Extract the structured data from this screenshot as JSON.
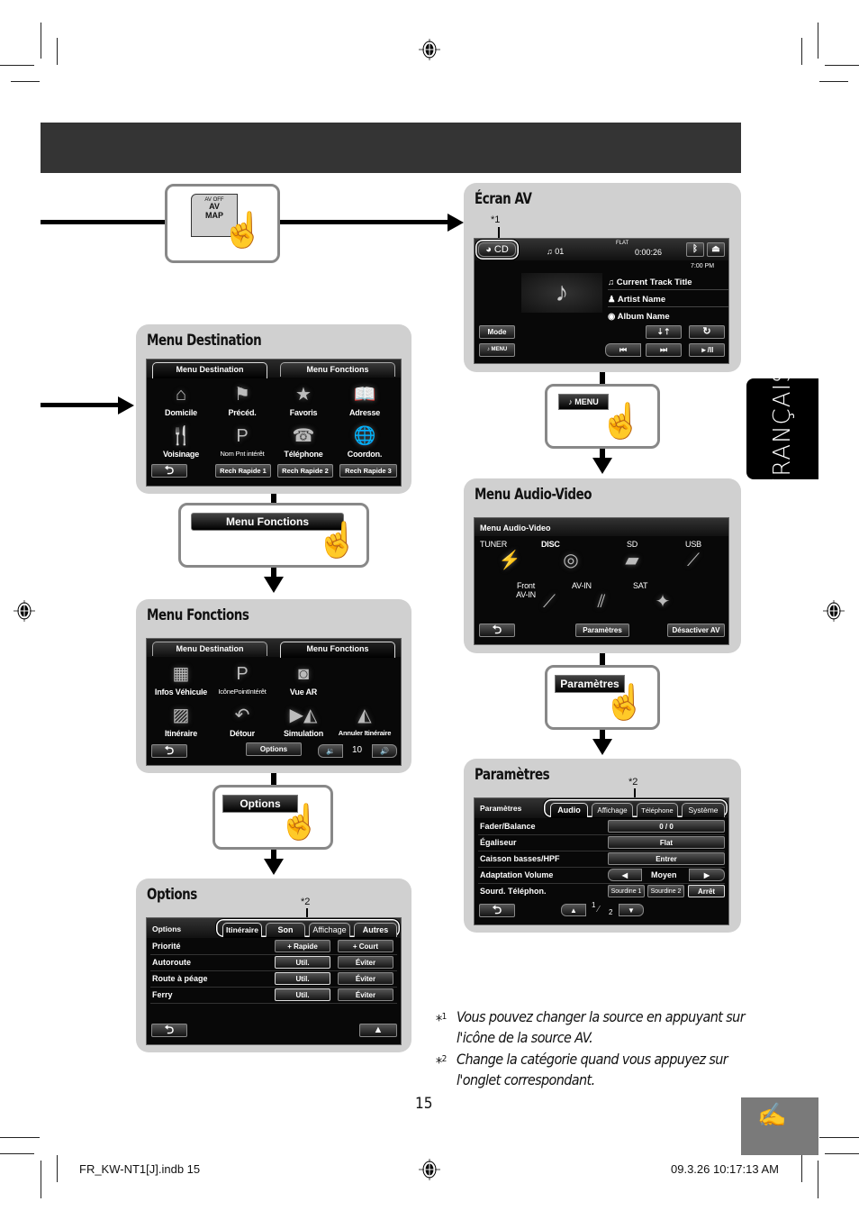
{
  "language_tab": "FRANÇAIS",
  "page_number": "15",
  "footer": {
    "file": "FR_KW-NT1[J].indb   15",
    "timestamp": "09.3.26   10:17:13 AM"
  },
  "colors": {
    "header_band": "#343434",
    "panel_bg": "#d0d0d0",
    "screen_bg": "#080808",
    "thumb_tab": "#7a7a7a"
  },
  "av_map_key": {
    "top_label": "AV OFF",
    "line1": "AV",
    "line2": "MAP"
  },
  "ecran_av": {
    "title": "Écran AV",
    "annotation": "*1",
    "source": "CD",
    "track": "01",
    "eq": "FLAT",
    "elapsed": "0:00:26",
    "clock": "7:00 PM",
    "track_title": "Current Track Title",
    "artist": "Artist Name",
    "album": "Album Name",
    "buttons": {
      "mode": "Mode",
      "menu": "MENU",
      "shuffle": "⇣⇡",
      "repeat": "↻",
      "prev": "⏮",
      "next": "⏭",
      "play_pause": "►/II"
    }
  },
  "menu_press": {
    "label": "MENU"
  },
  "menu_audio_video": {
    "title": "Menu Audio-Video",
    "header": "Menu Audio-Video",
    "sources": [
      {
        "label": "TUNER",
        "icon": "tower-icon"
      },
      {
        "label": "DISC",
        "icon": "disc-icon"
      },
      {
        "label": "SD",
        "icon": "sd-card-icon"
      },
      {
        "label": "USB",
        "icon": "usb-stick-icon"
      },
      {
        "label": "Front AV-IN",
        "icon": "jack-plug-icon"
      },
      {
        "label": "AV-IN",
        "icon": "rca-cable-icon"
      },
      {
        "label": "SAT",
        "icon": "satellite-icon"
      }
    ],
    "buttons": {
      "back": "⮌",
      "settings": "Paramètres",
      "disable_av": "Désactiver AV"
    }
  },
  "parametres_press": {
    "label": "Paramètres"
  },
  "parametres": {
    "title": "Paramètres",
    "annotation": "*2",
    "header": "Paramètres",
    "tabs": [
      "Audio",
      "Affichage",
      "Téléphone",
      "Système"
    ],
    "rows": [
      {
        "label": "Fader/Balance",
        "value": "0 / 0"
      },
      {
        "label": "Égaliseur",
        "value": "Flat"
      },
      {
        "label": "Caisson basses/HPF",
        "value": "Entrer"
      },
      {
        "label": "Adaptation Volume",
        "value": "Moyen"
      },
      {
        "label": "Sourd. Téléphon.",
        "options": [
          "Sourdine 1",
          "Sourdine 2",
          "Arrêt"
        ]
      }
    ],
    "page_current": "1",
    "page_total": "2"
  },
  "menu_destination": {
    "title": "Menu Destination",
    "tabs": [
      "Menu Destination",
      "Menu Fonctions"
    ],
    "items": [
      {
        "label": "Domicile",
        "icon": "house-icon"
      },
      {
        "label": "Précéd.",
        "icon": "flag-icon"
      },
      {
        "label": "Favoris",
        "icon": "star-icon"
      },
      {
        "label": "Adresse",
        "icon": "book-icon"
      },
      {
        "label": "Voisinage",
        "icon": "poi-nearby-icon"
      },
      {
        "label": "Nom Pnt intérêt",
        "icon": "poi-name-icon"
      },
      {
        "label": "Téléphone",
        "icon": "phone-icon"
      },
      {
        "label": "Coordon.",
        "icon": "globe-icon"
      }
    ],
    "quick": [
      "Rech Rapide 1",
      "Rech Rapide 2",
      "Rech Rapide 3"
    ]
  },
  "fonctions_press": {
    "label": "Menu Fonctions"
  },
  "menu_fonctions": {
    "title": "Menu Fonctions",
    "tabs": [
      "Menu Destination",
      "Menu Fonctions"
    ],
    "items": [
      {
        "label": "Infos Véhicule",
        "icon": "vehicle-info-icon"
      },
      {
        "label": "IcônePointIntérêt",
        "icon": "poi-icon"
      },
      {
        "label": "Vue AR",
        "icon": "camera-icon"
      },
      {
        "label": "Itinéraire",
        "icon": "route-icon"
      },
      {
        "label": "Détour",
        "icon": "detour-icon"
      },
      {
        "label": "Simulation",
        "icon": "simulation-icon"
      },
      {
        "label": "Annuler Itinéraire",
        "icon": "cancel-route-icon"
      }
    ],
    "options_label": "Options",
    "volume": "10"
  },
  "options_press": {
    "label": "Options"
  },
  "options": {
    "title": "Options",
    "annotation": "*2",
    "header": "Options",
    "tabs": [
      "Itinéraire",
      "Son",
      "Affichage",
      "Autres"
    ],
    "rows": [
      {
        "label": "Priorité",
        "a": "+ Rapide",
        "b": "+ Court"
      },
      {
        "label": "Autoroute",
        "a": "Util.",
        "b": "Éviter"
      },
      {
        "label": "Route à péage",
        "a": "Util.",
        "b": "Éviter"
      },
      {
        "label": "Ferry",
        "a": "Util.",
        "b": "Éviter"
      }
    ]
  },
  "notes": [
    {
      "mark": "*1",
      "text": "Vous pouvez changer la source en appuyant sur l'icône de la source AV."
    },
    {
      "mark": "*2",
      "text": "Change la catégorie quand vous appuyez sur l'onglet correspondant."
    }
  ]
}
